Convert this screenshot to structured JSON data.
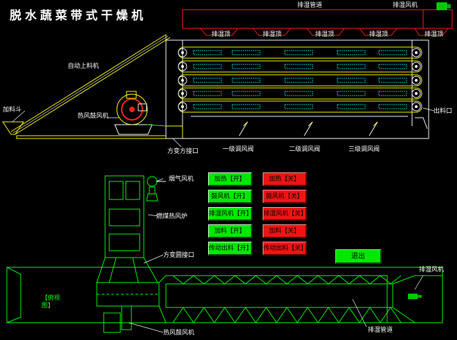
{
  "title": "脱水蔬菜带式干燥机",
  "labels": {
    "exhaust_pipe_top": "排湿管道",
    "exhaust_fan_top": "排湿风机",
    "exhaust_hood": "排湿顶",
    "auto_feeder": "自动上料机",
    "hopper": "加料斗",
    "hot_air_fan": "热风鼓风机",
    "outlet": "出料口",
    "square_joint": "方变方接口",
    "valve1": "一级调风阀",
    "valve2": "二级调风阀",
    "valve3": "三级调风阀",
    "smoke_fan": "烟气风机",
    "coal_furnace": "燃煤热风炉",
    "round_joint": "方变圆接口",
    "top_view": "【俯视图】",
    "exhaust_fan_bottom": "排湿风机",
    "hot_air_fan_bottom": "热风鼓风机",
    "exhaust_pipe_bottom": "排湿管道"
  },
  "controls": [
    {
      "on": "加热【开】",
      "off": "加热【关】"
    },
    {
      "on": "鼓风机【开】",
      "off": "鼓风机【关】"
    },
    {
      "on": "排湿风机【开】",
      "off": "排湿风机【关】"
    },
    {
      "on": "加料【开】",
      "off": "加料【关】"
    },
    {
      "on": "传动出料【开】",
      "off": "传动出料【关】"
    }
  ],
  "exit_label": "退出",
  "colors": {
    "background": "#000000",
    "line_red": "#ff2020",
    "line_yellow": "#ffff00",
    "line_green": "#00ff00",
    "belt_cyan": "#00c8c8",
    "button_on": "#00e800",
    "button_off": "#ee1414"
  }
}
